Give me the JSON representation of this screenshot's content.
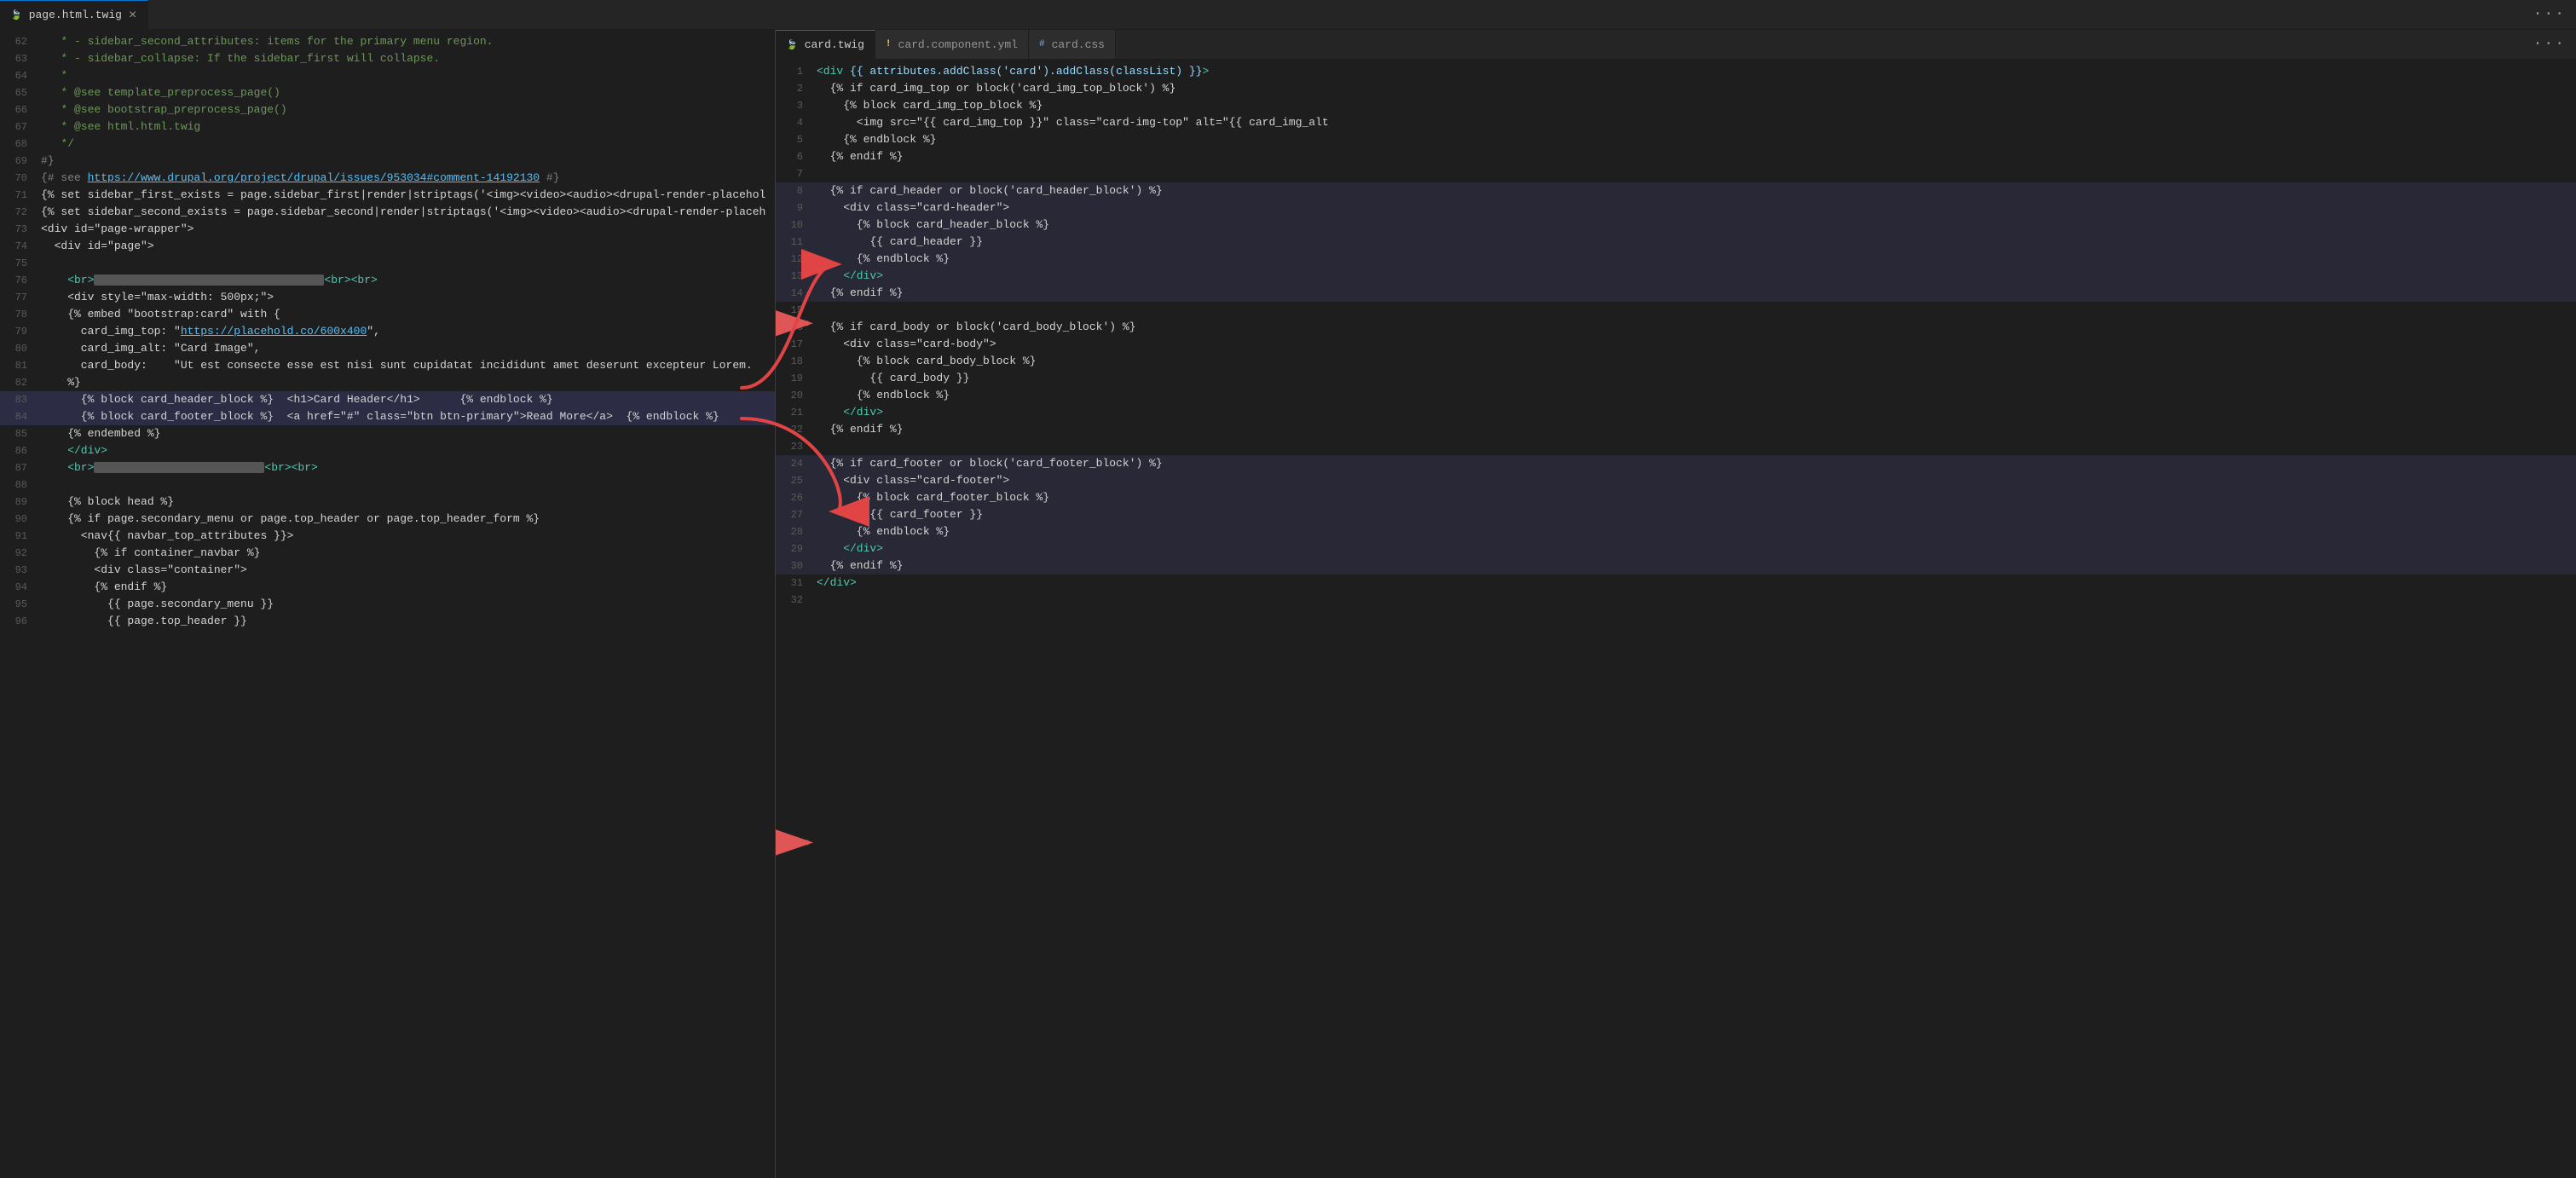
{
  "left_pane": {
    "tab_label": "page.html.twig",
    "tab_icon": "🐙",
    "title_file": "page.html.twig",
    "more_label": "···",
    "lines": [
      {
        "num": 62,
        "tokens": [
          {
            "t": "   * - sidebar_second_attributes: items for the primary menu region.",
            "c": "c-comment"
          }
        ]
      },
      {
        "num": 63,
        "tokens": [
          {
            "t": "   * - sidebar_collapse: If the sidebar_first will collapse.",
            "c": "c-comment"
          }
        ]
      },
      {
        "num": 64,
        "tokens": [
          {
            "t": "   *",
            "c": "c-comment"
          }
        ]
      },
      {
        "num": 65,
        "tokens": [
          {
            "t": "   * @see template_preprocess_page()",
            "c": "c-comment"
          }
        ]
      },
      {
        "num": 66,
        "tokens": [
          {
            "t": "   * @see bootstrap_preprocess_page()",
            "c": "c-comment"
          }
        ]
      },
      {
        "num": 67,
        "tokens": [
          {
            "t": "   * @see html.html.twig",
            "c": "c-comment"
          }
        ]
      },
      {
        "num": 68,
        "tokens": [
          {
            "t": "   */",
            "c": "c-comment"
          }
        ]
      },
      {
        "num": 69,
        "tokens": [
          {
            "t": "#}",
            "c": "c-twig-punct"
          }
        ]
      },
      {
        "num": 70,
        "tokens": [
          {
            "t": "{# see ",
            "c": "c-twig-punct"
          },
          {
            "t": "https://www.drupal.org/project/drupal/issues/953034#comment-14192130",
            "c": "c-url"
          },
          {
            "t": " #}",
            "c": "c-twig-punct"
          }
        ]
      },
      {
        "num": 71,
        "tokens": [
          {
            "t": "{% set sidebar_first_exists = page.sidebar_first|render|striptags('<img><video><audio><drupal-render-placehol",
            "c": "c-white"
          }
        ]
      },
      {
        "num": 72,
        "tokens": [
          {
            "t": "{% set sidebar_second_exists = page.sidebar_second|render|striptags('<img><video><audio><drupal-render-placeh",
            "c": "c-white"
          }
        ]
      },
      {
        "num": 73,
        "tokens": [
          {
            "t": "<div id=\"page-wrapper\">",
            "c": "c-white"
          }
        ]
      },
      {
        "num": 74,
        "tokens": [
          {
            "t": "  <div id=\"page\">",
            "c": "c-white"
          }
        ]
      },
      {
        "num": 75,
        "tokens": []
      },
      {
        "num": 76,
        "tokens": [
          {
            "t": "    <br>",
            "c": "c-html-tag"
          },
          {
            "t": "REDACTED_LONG",
            "c": "redacted"
          },
          {
            "t": "<br><br>",
            "c": "c-html-tag"
          }
        ]
      },
      {
        "num": 77,
        "tokens": [
          {
            "t": "    <div style=\"max-width: 500px;\">",
            "c": "c-white"
          }
        ]
      },
      {
        "num": 78,
        "tokens": [
          {
            "t": "    {% embed \"bootstrap:card\" with {",
            "c": "c-white"
          }
        ]
      },
      {
        "num": 79,
        "tokens": [
          {
            "t": "      card_img_top: \"",
            "c": "c-white"
          },
          {
            "t": "https://placehold.co/600x400",
            "c": "c-url"
          },
          {
            "t": "\",",
            "c": "c-white"
          }
        ]
      },
      {
        "num": 80,
        "tokens": [
          {
            "t": "      card_img_alt: \"Card Image\",",
            "c": "c-white"
          }
        ]
      },
      {
        "num": 81,
        "tokens": [
          {
            "t": "      card_body:    \"Ut est consecte esse est nisi sunt cupidatat incididunt amet deserunt excepteur Lorem.",
            "c": "c-white"
          }
        ]
      },
      {
        "num": 82,
        "tokens": [
          {
            "t": "    %}"
          }
        ]
      },
      {
        "num": 83,
        "tokens": [
          {
            "t": "      {% block card_header_block %}  <h1>Card Header</h1>      {% endblock %}",
            "c": "c-white"
          }
        ],
        "highlight": true
      },
      {
        "num": 84,
        "tokens": [
          {
            "t": "      {% block card_footer_block %}  <a href=\"#\" class=\"btn btn-primary\">Read More</a>  {% endblock %}",
            "c": "c-white"
          }
        ],
        "highlight": true
      },
      {
        "num": 85,
        "tokens": [
          {
            "t": "    {% endembed %}",
            "c": "c-white"
          }
        ]
      },
      {
        "num": 86,
        "tokens": [
          {
            "t": "    </div>",
            "c": "c-html-tag"
          }
        ]
      },
      {
        "num": 87,
        "tokens": [
          {
            "t": "    <br>",
            "c": "c-html-tag"
          },
          {
            "t": "REDACTED_SHORT",
            "c": "redacted"
          },
          {
            "t": "<br><br>",
            "c": "c-html-tag"
          }
        ]
      },
      {
        "num": 88,
        "tokens": []
      },
      {
        "num": 89,
        "tokens": [
          {
            "t": "    {% block head %}",
            "c": "c-white"
          }
        ]
      },
      {
        "num": 90,
        "tokens": [
          {
            "t": "    {% if page.secondary_menu or page.top_header or page.top_header_form %}",
            "c": "c-white"
          }
        ]
      },
      {
        "num": 91,
        "tokens": [
          {
            "t": "      <nav{{ navbar_top_attributes }}>",
            "c": "c-white"
          }
        ]
      },
      {
        "num": 92,
        "tokens": [
          {
            "t": "        {% if container_navbar %}",
            "c": "c-white"
          }
        ]
      },
      {
        "num": 93,
        "tokens": [
          {
            "t": "        <div class=\"container\">",
            "c": "c-white"
          }
        ]
      },
      {
        "num": 94,
        "tokens": [
          {
            "t": "        {% endif %}",
            "c": "c-white"
          }
        ]
      },
      {
        "num": 95,
        "tokens": [
          {
            "t": "          {{ page.secondary_menu }}",
            "c": "c-white"
          }
        ]
      },
      {
        "num": 96,
        "tokens": [
          {
            "t": "          {{ page.top_header }}",
            "c": "c-white"
          }
        ]
      }
    ]
  },
  "right_pane": {
    "tabs": [
      {
        "label": "card.twig",
        "active": true,
        "icon": "twig"
      },
      {
        "label": "card.component.yml",
        "active": false,
        "icon": "yaml"
      },
      {
        "label": "card.css",
        "active": false,
        "icon": "css"
      }
    ],
    "more_label": "···",
    "title_file": "card.twig",
    "lines": [
      {
        "num": 1,
        "tokens": [
          {
            "t": "<div",
            "c": "c-html-tag"
          },
          {
            "t": " {{ attributes.addClass('card').addClass(classList) }}",
            "c": "c-twig-var"
          },
          {
            "t": ">",
            "c": "c-html-tag"
          }
        ]
      },
      {
        "num": 2,
        "tokens": [
          {
            "t": "  {% if card_img_top or block('card_img_top_block') %}",
            "c": "c-white"
          }
        ]
      },
      {
        "num": 3,
        "tokens": [
          {
            "t": "    {% block card_img_top_block %}",
            "c": "c-white"
          }
        ]
      },
      {
        "num": 4,
        "tokens": [
          {
            "t": "      <img src=\"{{ card_img_top }}\" class=\"card-img-top\" alt=\"{{ card_img_alt",
            "c": "c-white"
          }
        ]
      },
      {
        "num": 5,
        "tokens": [
          {
            "t": "    {% endblock %}",
            "c": "c-white"
          }
        ]
      },
      {
        "num": 6,
        "tokens": [
          {
            "t": "  {% endif %}",
            "c": "c-white"
          }
        ]
      },
      {
        "num": 7,
        "tokens": []
      },
      {
        "num": 8,
        "tokens": [
          {
            "t": "  {% if card_header or block('card_header_block') %}",
            "c": "c-white"
          }
        ],
        "block_start": true
      },
      {
        "num": 9,
        "tokens": [
          {
            "t": "    <div class=\"card-header\">",
            "c": "c-white"
          }
        ]
      },
      {
        "num": 10,
        "tokens": [
          {
            "t": "      {% block card_header_block %}",
            "c": "c-white"
          }
        ]
      },
      {
        "num": 11,
        "tokens": [
          {
            "t": "        {{ card_header }}",
            "c": "c-white"
          }
        ]
      },
      {
        "num": 12,
        "tokens": [
          {
            "t": "      {% endblock %}",
            "c": "c-white"
          }
        ]
      },
      {
        "num": 13,
        "tokens": [
          {
            "t": "    </div>",
            "c": "c-html-tag"
          }
        ]
      },
      {
        "num": 14,
        "tokens": [
          {
            "t": "  {% endif %}",
            "c": "c-white"
          }
        ],
        "block_end": true
      },
      {
        "num": 15,
        "tokens": []
      },
      {
        "num": 16,
        "tokens": [
          {
            "t": "  {% if card_body or block('card_body_block') %}",
            "c": "c-white"
          }
        ]
      },
      {
        "num": 17,
        "tokens": [
          {
            "t": "    <div class=\"card-body\">",
            "c": "c-white"
          }
        ]
      },
      {
        "num": 18,
        "tokens": [
          {
            "t": "      {% block card_body_block %}",
            "c": "c-white"
          }
        ]
      },
      {
        "num": 19,
        "tokens": [
          {
            "t": "        {{ card_body }}",
            "c": "c-white"
          }
        ]
      },
      {
        "num": 20,
        "tokens": [
          {
            "t": "      {% endblock %}",
            "c": "c-white"
          }
        ]
      },
      {
        "num": 21,
        "tokens": [
          {
            "t": "    </div>",
            "c": "c-html-tag"
          }
        ]
      },
      {
        "num": 22,
        "tokens": [
          {
            "t": "  {% endif %}",
            "c": "c-white"
          }
        ]
      },
      {
        "num": 23,
        "tokens": []
      },
      {
        "num": 24,
        "tokens": [
          {
            "t": "  {% if card_footer or block('card_footer_block') %}",
            "c": "c-white"
          }
        ],
        "block_start": true
      },
      {
        "num": 25,
        "tokens": [
          {
            "t": "    <div class=\"card-footer\">",
            "c": "c-white"
          }
        ]
      },
      {
        "num": 26,
        "tokens": [
          {
            "t": "      {% block card_footer_block %}",
            "c": "c-white"
          }
        ]
      },
      {
        "num": 27,
        "tokens": [
          {
            "t": "        {{ card_footer }}",
            "c": "c-white"
          }
        ]
      },
      {
        "num": 28,
        "tokens": [
          {
            "t": "      {% endblock %}",
            "c": "c-white"
          }
        ]
      },
      {
        "num": 29,
        "tokens": [
          {
            "t": "    </div>",
            "c": "c-html-tag"
          }
        ]
      },
      {
        "num": 30,
        "tokens": [
          {
            "t": "  {% endif %}",
            "c": "c-white"
          }
        ],
        "block_end": true
      },
      {
        "num": 31,
        "tokens": [
          {
            "t": "</div>",
            "c": "c-html-tag"
          }
        ]
      },
      {
        "num": 32,
        "tokens": []
      }
    ],
    "block_ranges": [
      [
        8,
        14
      ],
      [
        24,
        30
      ]
    ]
  },
  "icons": {
    "twig_file": "🍃",
    "yaml_file": "📄",
    "css_file": "#",
    "more": "···"
  }
}
